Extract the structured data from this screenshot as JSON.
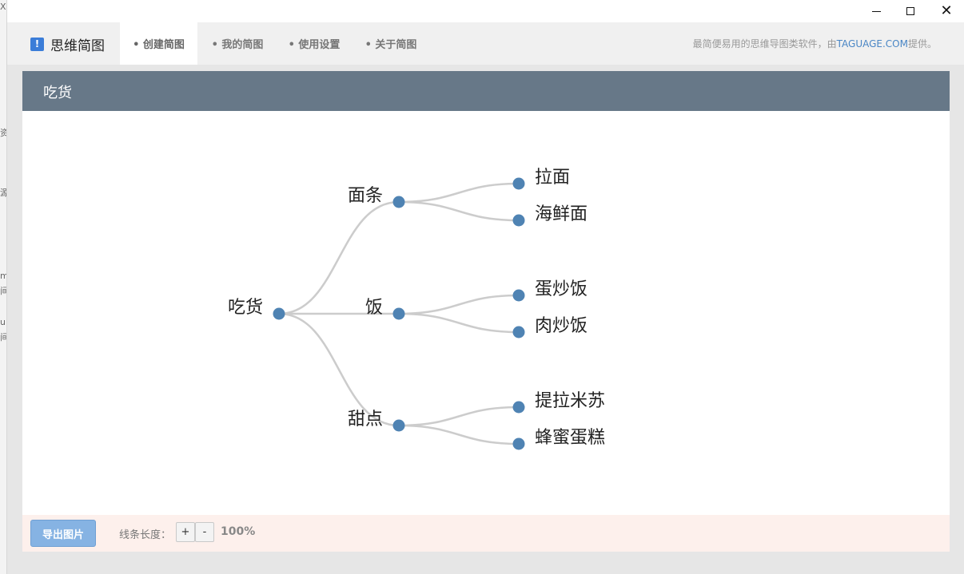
{
  "nav": {
    "brand": "思维简图",
    "brand_icon": "!",
    "tabs": [
      {
        "label": "• 创建简图",
        "active": true
      },
      {
        "label": "• 我的简图",
        "active": false
      },
      {
        "label": "• 使用设置",
        "active": false
      },
      {
        "label": "• 关于简图",
        "active": false
      }
    ],
    "tagline_prefix": "最简便易用的思维导图类软件，由",
    "tagline_link": "TAGUAGE.COM",
    "tagline_suffix": "提供。"
  },
  "background_window": {
    "fragments": [
      "X",
      "资",
      "源",
      "m",
      "间",
      "u",
      "间"
    ]
  },
  "panel": {
    "title": "吃货"
  },
  "mindmap": {
    "root": "吃货",
    "branches": [
      {
        "label": "面条",
        "children": [
          "拉面",
          "海鲜面"
        ]
      },
      {
        "label": "饭",
        "children": [
          "蛋炒饭",
          "肉炒饭"
        ]
      },
      {
        "label": "甜点",
        "children": [
          "提拉米苏",
          "蜂蜜蛋糕"
        ]
      }
    ],
    "node_color": "#4f83b3",
    "link_color": "#cccccc"
  },
  "footer": {
    "export_label": "导出图片",
    "line_length_label": "线条长度：",
    "plus_label": "+",
    "minus_label": "-",
    "zoom": "100%"
  },
  "colors": {
    "header_bg": "#677888",
    "footer_bg": "#fdf0ec",
    "accent": "#3b7dd8"
  }
}
